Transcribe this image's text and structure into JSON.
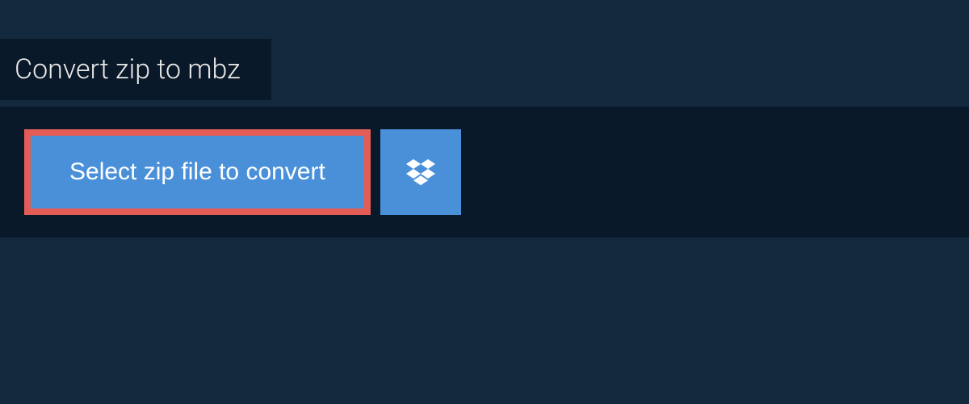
{
  "header": {
    "tab_label": "Convert zip to mbz"
  },
  "actions": {
    "select_file_label": "Select zip file to convert"
  }
}
